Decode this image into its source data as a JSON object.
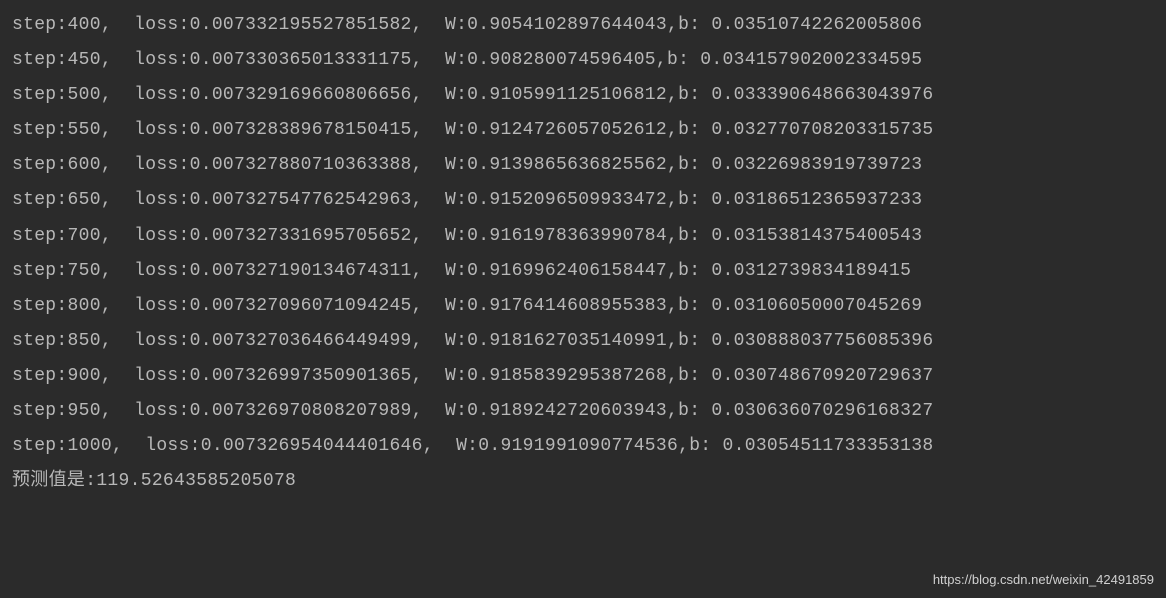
{
  "lines": [
    {
      "step": "400",
      "loss": "0.007332195527851582",
      "W": "0.9054102897644043",
      "b": "0.03510742262005806"
    },
    {
      "step": "450",
      "loss": "0.007330365013331175",
      "W": "0.908280074596405",
      "b": "0.034157902002334595"
    },
    {
      "step": "500",
      "loss": "0.007329169660806656",
      "W": "0.9105991125106812",
      "b": "0.033390648663043976"
    },
    {
      "step": "550",
      "loss": "0.007328389678150415",
      "W": "0.9124726057052612",
      "b": "0.032770708203315735"
    },
    {
      "step": "600",
      "loss": "0.007327880710363388",
      "W": "0.9139865636825562",
      "b": "0.03226983919739723"
    },
    {
      "step": "650",
      "loss": "0.007327547762542963",
      "W": "0.9152096509933472",
      "b": "0.03186512365937233"
    },
    {
      "step": "700",
      "loss": "0.007327331695705652",
      "W": "0.9161978363990784",
      "b": "0.03153814375400543"
    },
    {
      "step": "750",
      "loss": "0.007327190134674311",
      "W": "0.9169962406158447",
      "b": "0.0312739834189415"
    },
    {
      "step": "800",
      "loss": "0.007327096071094245",
      "W": "0.9176414608955383",
      "b": "0.03106050007045269"
    },
    {
      "step": "850",
      "loss": "0.007327036466449499",
      "W": "0.9181627035140991",
      "b": "0.030888037756085396"
    },
    {
      "step": "900",
      "loss": "0.007326997350901365",
      "W": "0.9185839295387268",
      "b": "0.030748670920729637"
    },
    {
      "step": "950",
      "loss": "0.007326970808207989",
      "W": "0.9189242720603943",
      "b": "0.030636070296168327"
    },
    {
      "step": "1000",
      "loss": "0.007326954044401646",
      "W": "0.9191991090774536",
      "b": "0.03054511733353138"
    }
  ],
  "prediction": {
    "label": "预测值是:",
    "value": "119.52643585205078"
  },
  "watermark": "https://blog.csdn.net/weixin_42491859"
}
